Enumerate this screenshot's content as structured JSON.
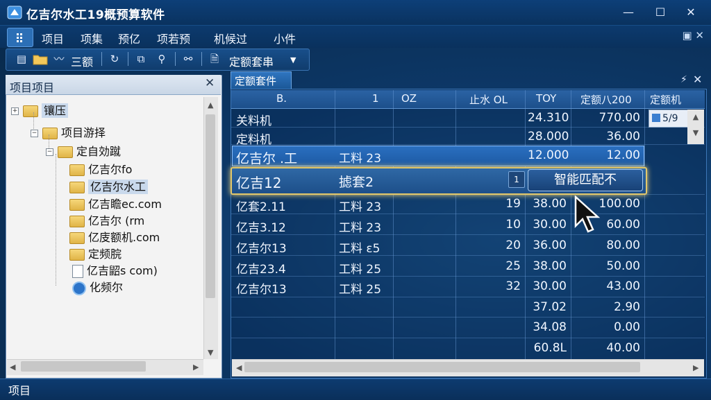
{
  "window": {
    "title": "亿吉尔水工19概预算软件",
    "minimize": "—",
    "maximize": "☐",
    "close": "✕"
  },
  "menu": {
    "items": [
      "项目",
      "项集",
      "预亿",
      "项若预",
      "机候过",
      "小件"
    ],
    "right_icons": "▣ ✕"
  },
  "toolbar": {
    "label1": "三额",
    "dropdown_label": "定额套串",
    "dropdown_arrow": "▼"
  },
  "left_panel": {
    "title": "项目项目",
    "close": "✕",
    "tree": [
      {
        "label": "镶压",
        "level": 0,
        "expander": "+",
        "kind": "folder",
        "selected": true
      },
      {
        "label": "项目游择",
        "level": 1,
        "expander": "−",
        "kind": "folder"
      },
      {
        "label": "定自効蹴",
        "level": 2,
        "expander": "−",
        "kind": "folder"
      },
      {
        "label": "亿吉尔fo",
        "level": 3,
        "kind": "folder"
      },
      {
        "label": "亿吉尔水工",
        "level": 3,
        "kind": "folder",
        "selected": true
      },
      {
        "label": "亿吉瞻ec.com",
        "level": 3,
        "kind": "folder"
      },
      {
        "label": "亿吉尔 (rm",
        "level": 3,
        "kind": "folder"
      },
      {
        "label": "亿庋额机.com",
        "level": 3,
        "kind": "folder"
      },
      {
        "label": "定频脘",
        "level": 3,
        "kind": "folder"
      },
      {
        "label": "亿吉鼦s com)",
        "level": 3,
        "kind": "doc"
      },
      {
        "label": "化频尔",
        "level": 3,
        "kind": "gear"
      }
    ]
  },
  "right_panel": {
    "tab": "定额套件",
    "pin": "⚡",
    "close": "✕",
    "headers": [
      "B.",
      "1",
      "OZ",
      "止水 OL",
      "TOY",
      "定额八200",
      "定额机"
    ],
    "side_item": "5/9",
    "match_button": "智能匹配不",
    "small_button": "1",
    "rows": [
      {
        "c1": "关料机",
        "c2": "",
        "c3": "",
        "c4": "",
        "c5": "24.310",
        "c6": "770.00"
      },
      {
        "c1": "定料机",
        "c2": "",
        "c3": "",
        "c4": "",
        "c5": "28.000",
        "c6": "36.00"
      },
      {
        "c1": "亿吉尔 .工",
        "c2": "工料 23",
        "c3": "",
        "c4": "",
        "c5": "12.000",
        "c6": "12.00"
      },
      {
        "c1": "亿吉12",
        "c2": "摅套2",
        "c3": "",
        "c4": "",
        "c5": "",
        "c6": ""
      },
      {
        "c1": "亿套2.11",
        "c2": "工料 23",
        "c3": "",
        "c4": "19",
        "c5": "38.00",
        "c6": "100.00"
      },
      {
        "c1": "亿吉3.12",
        "c2": "工料 23",
        "c3": "",
        "c4": "10",
        "c5": "30.00",
        "c6": "60.00"
      },
      {
        "c1": "亿吉尔13",
        "c2": "工料 ε5",
        "c3": "",
        "c4": "20",
        "c5": "36.00",
        "c6": "80.00"
      },
      {
        "c1": "亿吉23.4",
        "c2": "工料 25",
        "c3": "",
        "c4": "25",
        "c5": "38.00",
        "c6": "50.00"
      },
      {
        "c1": "亿吉尔13",
        "c2": "工料 25",
        "c3": "",
        "c4": "32",
        "c5": "30.00",
        "c6": "43.00"
      },
      {
        "c1": "",
        "c2": "",
        "c3": "",
        "c4": "",
        "c5": "37.02",
        "c6": "2.90"
      },
      {
        "c1": "",
        "c2": "",
        "c3": "",
        "c4": "",
        "c5": "34.08",
        "c6": "0.00"
      },
      {
        "c1": "",
        "c2": "",
        "c3": "",
        "c4": "",
        "c5": "60.8L",
        "c6": "40.00"
      }
    ]
  },
  "status": {
    "text": "项目"
  }
}
